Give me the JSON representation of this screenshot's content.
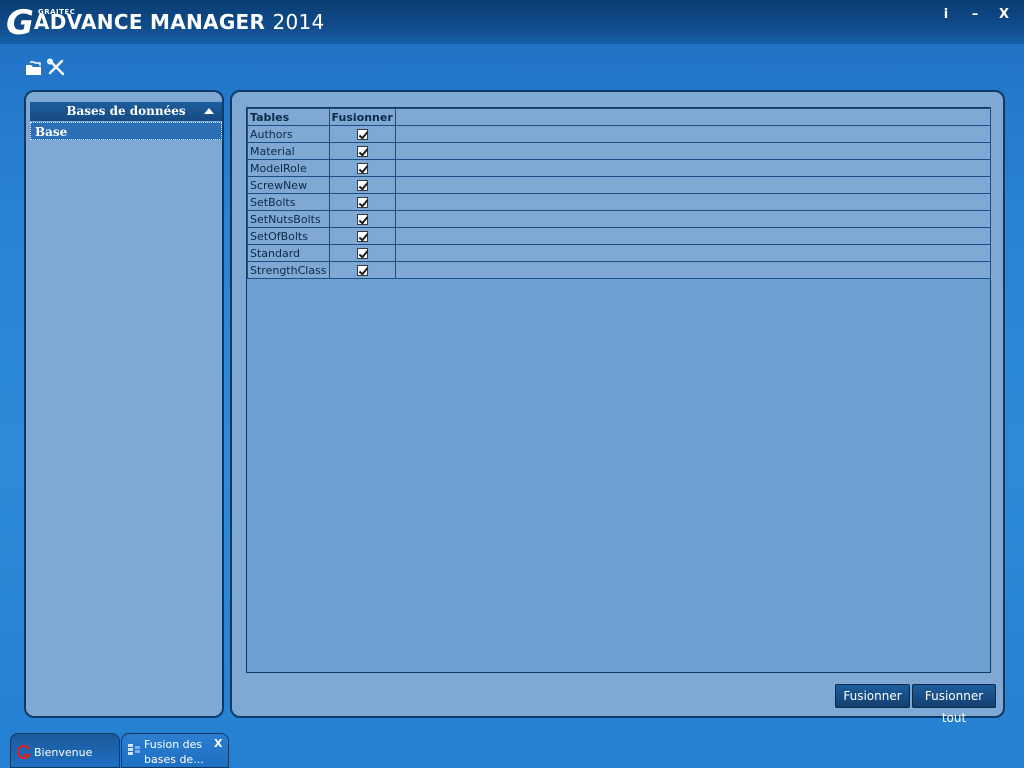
{
  "window": {
    "logo_g": "G",
    "logo_brand": "GRAITEC",
    "logo_title": "ADVANCE MANAGER",
    "logo_year": "2014",
    "btn_info": "i",
    "btn_minimize": "–",
    "btn_close": "X"
  },
  "toolbar": {
    "icons": [
      "folder-open-icon",
      "tools-icon"
    ]
  },
  "databases": {
    "header": "Bases de données",
    "items": [
      "Base"
    ]
  },
  "grid": {
    "columns": [
      "Tables",
      "Fusionner"
    ],
    "rows": [
      {
        "name": "Authors",
        "merge": true
      },
      {
        "name": "Material",
        "merge": true
      },
      {
        "name": "ModelRole",
        "merge": true
      },
      {
        "name": "ScrewNew",
        "merge": true
      },
      {
        "name": "SetBolts",
        "merge": true
      },
      {
        "name": "SetNutsBolts",
        "merge": true
      },
      {
        "name": "SetOfBolts",
        "merge": true
      },
      {
        "name": "Standard",
        "merge": true
      },
      {
        "name": "StrengthClass",
        "merge": true
      }
    ]
  },
  "actions": {
    "merge": "Fusionner",
    "merge_all": "Fusionner tout"
  },
  "tabs": {
    "welcome": "Bienvenue",
    "merge_line1": "Fusion des",
    "merge_line2": "bases de...",
    "close": "X"
  }
}
